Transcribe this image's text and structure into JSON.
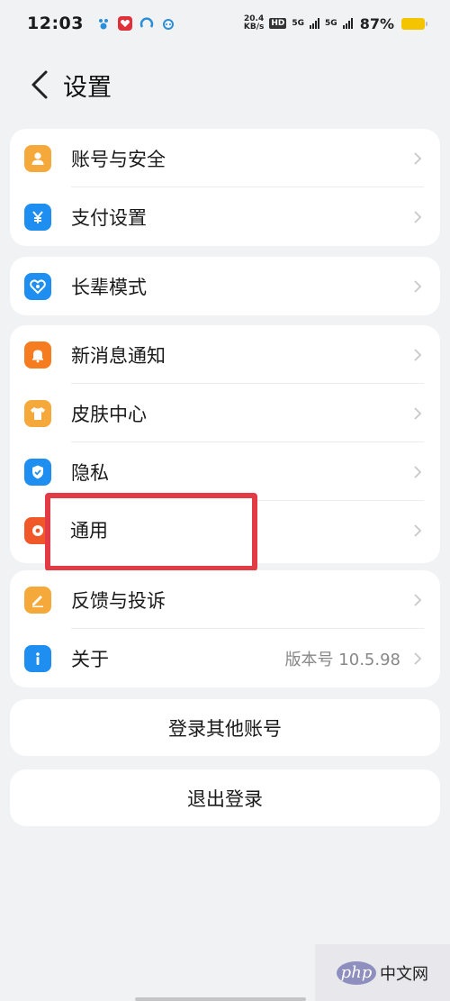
{
  "status_bar": {
    "time": "12:03",
    "speed_top": "20.4",
    "speed_bottom": "KB/s",
    "hd_tag": "HD",
    "net1": "5G",
    "net2": "5G",
    "battery_text": "87%",
    "battery_level": 0.87,
    "app_icons": [
      "paw-icon",
      "app-red-icon",
      "loop-icon",
      "cat-icon"
    ]
  },
  "header": {
    "title": "设置"
  },
  "groups": [
    {
      "items": [
        {
          "label": "账号与安全",
          "icon": "person-icon",
          "color": "#f6a93b"
        },
        {
          "label": "支付设置",
          "icon": "yen-icon",
          "color": "#1f8ef1"
        }
      ]
    },
    {
      "items": [
        {
          "label": "长辈模式",
          "icon": "heart-shield-icon",
          "color": "#1f8ef1"
        }
      ]
    },
    {
      "items": [
        {
          "label": "新消息通知",
          "icon": "bell-icon",
          "color": "#f57c1f"
        },
        {
          "label": "皮肤中心",
          "icon": "shirt-icon",
          "color": "#f6a93b"
        },
        {
          "label": "隐私",
          "icon": "shield-check-icon",
          "color": "#1f8ef1"
        },
        {
          "label": "通用",
          "icon": "gear-icon",
          "color": "#f0582a"
        }
      ]
    },
    {
      "items": [
        {
          "label": "反馈与投诉",
          "icon": "pencil-icon",
          "color": "#f6a93b"
        },
        {
          "label": "关于",
          "icon": "info-icon",
          "color": "#1f8ef1",
          "value": "版本号 10.5.98"
        }
      ]
    }
  ],
  "buttons": {
    "switch_account": "登录其他账号",
    "logout": "退出登录"
  },
  "watermark": {
    "php": "php",
    "text": "中文网"
  },
  "highlight_color": "#e23b45"
}
